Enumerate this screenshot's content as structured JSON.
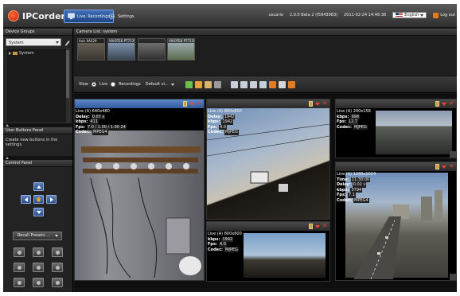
{
  "app": {
    "name": "IPCorder",
    "nav": [
      {
        "label": "Live, Recordings",
        "active": true
      },
      {
        "label": "Settings",
        "active": false
      }
    ],
    "user": "usuario",
    "version": "2.0.0 Beta 2 (f5843983)",
    "datetime": "2011-02-24 14:46:38",
    "language": "English",
    "logout_label": "Log out"
  },
  "left": {
    "device_groups_title": "Device Groups",
    "group_select_value": "System",
    "tree_items": [
      {
        "label": "System"
      }
    ],
    "user_buttons_title": "User Buttons Panel",
    "user_buttons_hint": "Create new buttons in the settings.",
    "control_panel_title": "Control Panel",
    "presets_label": "Recall Presets ..."
  },
  "camera_list": {
    "title": "Camera List: system",
    "thumbnails": [
      "Axis 0A229",
      "VIVOTEK PT7135",
      "",
      "VIVOTEK PT7135"
    ]
  },
  "toolbar": {
    "view_label": "View",
    "live_label": "Live",
    "recordings_label": "Recordings",
    "layout_label": "Default vi..."
  },
  "tiles": [
    {
      "id": "t1",
      "title": "Live (A) 640x480",
      "selected": true,
      "stats": [
        {
          "key": "Delay:",
          "val": "0.07 s"
        },
        {
          "key": "kbps:",
          "val": "411"
        },
        {
          "key": "Fps:",
          "val": "7.0 / 1.00 / 1.00 24"
        },
        {
          "key": "Codec:",
          "val": "MPEG4"
        }
      ]
    },
    {
      "id": "t2",
      "title": "Live (A) 800x600",
      "selected": false,
      "stats": [
        {
          "key": "Delay:",
          "val": "1942"
        },
        {
          "key": "kbps:",
          "val": "1942"
        },
        {
          "key": "Fps:",
          "val": "4.0"
        },
        {
          "key": "Codec:",
          "val": "MJPEG"
        }
      ]
    },
    {
      "id": "t3",
      "title": "Live (A) 200x158",
      "selected": false,
      "stats": [
        {
          "key": "kbps:",
          "val": "998"
        },
        {
          "key": "Fps:",
          "val": "12.7"
        },
        {
          "key": "Codec:",
          "val": "MJPEG"
        }
      ]
    },
    {
      "id": "t4",
      "title": "Live (A) 800x600",
      "selected": false,
      "stats": [
        {
          "key": "kbps:",
          "val": "1942"
        },
        {
          "key": "Fps:",
          "val": "4.0"
        },
        {
          "key": "Codec:",
          "val": "MJPEG"
        }
      ]
    },
    {
      "id": "t5",
      "title": "Live (A) 1280x1024",
      "selected": true,
      "stats": [
        {
          "key": "Time:",
          "val": "11:30:00"
        },
        {
          "key": "Delay:",
          "val": "0.02 s"
        },
        {
          "key": "kbps:",
          "val": "3794"
        },
        {
          "key": "Fps:",
          "val": "7.1"
        },
        {
          "key": "Codec:",
          "val": "MPEG4"
        }
      ]
    }
  ],
  "colors": {
    "accent_blue": "#3d6fb8",
    "close_red": "#ff3b2b",
    "logo_orange": "#e8401c"
  }
}
